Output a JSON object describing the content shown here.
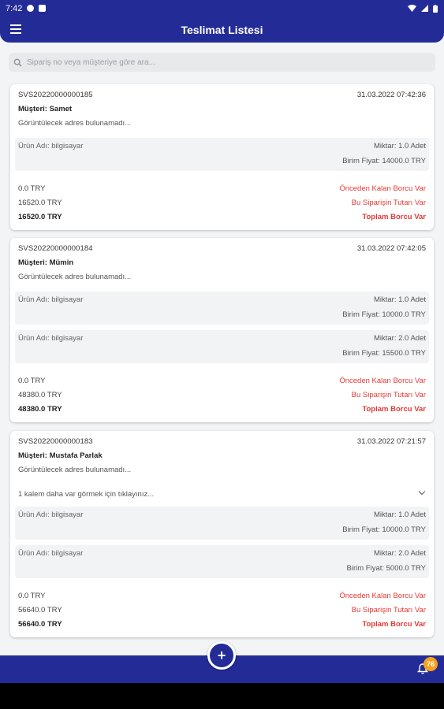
{
  "status_bar": {
    "time": "7:42"
  },
  "app_bar": {
    "title": "Teslimat Listesi"
  },
  "search": {
    "placeholder": "Sipariş no veya müşteriye göre ara..."
  },
  "orders": [
    {
      "id": "SVS20220000000185",
      "date": "31.03.2022 07:42:36",
      "customer": "Müşteri: Samet",
      "address": "Görüntülecek adres bulunamadı...",
      "items": [
        {
          "name": "Ürün Adı: bilgisayar",
          "quantity": "Miktar: 1.0 Adet",
          "unit_price": "Birim Fiyat: 14000.0 TRY"
        }
      ],
      "previous_debt": "0.0 TRY",
      "order_amount": "16520.0 TRY",
      "total_debt": "16520.0 TRY",
      "previous_debt_label": "Önceden Kalan Borcu Var",
      "order_amount_label": "Bu Siparişin Tutarı Var",
      "total_debt_label": "Toplam Borcu Var"
    },
    {
      "id": "SVS20220000000184",
      "date": "31.03.2022 07:42:05",
      "customer": "Müşteri: Mümin",
      "address": "Görüntülecek adres bulunamadı...",
      "items": [
        {
          "name": "Ürün Adı: bilgisayar",
          "quantity": "Miktar: 1.0 Adet",
          "unit_price": "Birim Fiyat: 10000.0 TRY"
        },
        {
          "name": "Ürün Adı: bilgisayar",
          "quantity": "Miktar: 2.0 Adet",
          "unit_price": "Birim Fiyat: 15500.0 TRY"
        }
      ],
      "previous_debt": "0.0 TRY",
      "order_amount": "48380.0 TRY",
      "total_debt": "48380.0 TRY",
      "previous_debt_label": "Önceden Kalan Borcu Var",
      "order_amount_label": "Bu Siparişin Tutarı Var",
      "total_debt_label": "Toplam Borcu Var"
    },
    {
      "id": "SVS20220000000183",
      "date": "31.03.2022 07:21:57",
      "customer": "Müşteri: Mustafa Parlak",
      "address": "Görüntülecek adres bulunamadı...",
      "more_items": "1 kalem daha var görmek için tıklayınız...",
      "items": [
        {
          "name": "Ürün Adı: bilgisayar",
          "quantity": "Miktar: 1.0 Adet",
          "unit_price": "Birim Fiyat: 10000.0 TRY"
        },
        {
          "name": "Ürün Adı: bilgisayar",
          "quantity": "Miktar: 2.0 Adet",
          "unit_price": "Birim Fiyat: 5000.0 TRY"
        }
      ],
      "previous_debt": "0.0 TRY",
      "order_amount": "56640.0 TRY",
      "total_debt": "56640.0 TRY",
      "previous_debt_label": "Önceden Kalan Borcu Var",
      "order_amount_label": "Bu Siparişin Tutarı Var",
      "total_debt_label": "Toplam Borcu Var"
    }
  ],
  "bottom": {
    "fab": "+",
    "notification_count": "76"
  },
  "colors": {
    "primary": "#232c96",
    "debt_red": "#e53935",
    "badge": "#f6a21c"
  }
}
